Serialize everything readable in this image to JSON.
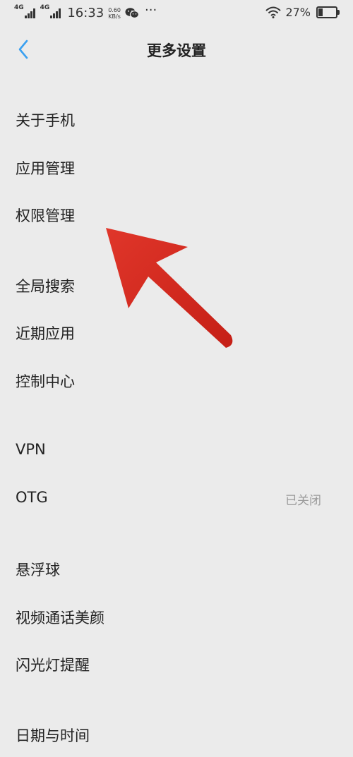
{
  "status_bar": {
    "network_1": "4G",
    "network_2": "4G",
    "time": "16:33",
    "speed_value": "0.60",
    "speed_unit": "KB/s",
    "more_indicator": "···",
    "battery_percent": "27%",
    "battery_level": 0.27
  },
  "header": {
    "title": "更多设置"
  },
  "menu": {
    "items": [
      {
        "label": "关于手机"
      },
      {
        "label": "应用管理"
      },
      {
        "label": "权限管理"
      },
      {
        "label": "全局搜索"
      },
      {
        "label": "近期应用"
      },
      {
        "label": "控制中心"
      },
      {
        "label": "VPN"
      },
      {
        "label": "OTG",
        "value": "已关闭"
      },
      {
        "label": "悬浮球"
      },
      {
        "label": "视频通话美颜"
      },
      {
        "label": "闪光灯提醒"
      },
      {
        "label": "日期与时间"
      }
    ]
  },
  "colors": {
    "background": "#ebebeb",
    "accent": "#3aa0f0",
    "annotation_arrow": "#d42a1f"
  }
}
